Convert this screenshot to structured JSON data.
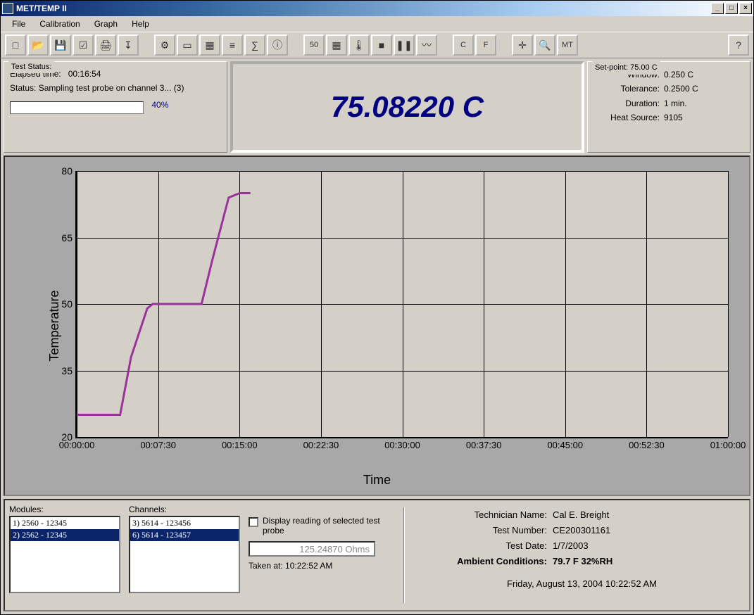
{
  "title": "MET/TEMP II",
  "menu": {
    "file": "File",
    "calibration": "Calibration",
    "graph": "Graph",
    "help": "Help"
  },
  "status": {
    "title": "Test Status:",
    "elapsed_label": "Elapsed time:",
    "elapsed_value": "00:16:54",
    "status_text": "Status: Sampling test probe on channel 3...   (3)",
    "progress_pct": "40%"
  },
  "reading": "75.08220 C",
  "setpoint": {
    "title": "Set-point: 75.00 C",
    "window_label": "Window:",
    "window_value": "0.250 C",
    "tolerance_label": "Tolerance:",
    "tolerance_value": "0.2500 C",
    "duration_label": "Duration:",
    "duration_value": "1 min.",
    "heatsource_label": "Heat Source:",
    "heatsource_value": "9105"
  },
  "chart_data": {
    "type": "line",
    "title": "",
    "xlabel": "Time",
    "ylabel": "Temperature",
    "ylim": [
      20,
      80
    ],
    "y_ticks": [
      20,
      35,
      50,
      65,
      80
    ],
    "x_ticks": [
      "00:00:00",
      "00:07:30",
      "00:15:00",
      "00:22:30",
      "00:30:00",
      "00:37:30",
      "00:45:00",
      "00:52:30",
      "01:00:00"
    ],
    "series": [
      {
        "name": "Temperature",
        "color": "#993399",
        "x": [
          "00:00:00",
          "00:04:00",
          "00:05:00",
          "00:06:30",
          "00:07:00",
          "00:11:30",
          "00:12:30",
          "00:14:00",
          "00:15:00",
          "00:16:00"
        ],
        "y": [
          25,
          25,
          38,
          49,
          50,
          50,
          60,
          74,
          75,
          75
        ]
      }
    ]
  },
  "modules": {
    "label": "Modules:",
    "items": [
      "1) 2560 - 12345",
      "2) 2562 - 12345"
    ],
    "selected": 1
  },
  "channels": {
    "label": "Channels:",
    "items": [
      "3) 5614 - 123456",
      "6) 5614 - 123457"
    ],
    "selected": 1
  },
  "display_reading": {
    "checkbox_label": "Display reading of selected test probe",
    "value": "125.24870 Ohms",
    "taken_label": "Taken at:",
    "taken_value": "10:22:52 AM"
  },
  "info": {
    "tech_label": "Technician Name:",
    "tech_value": "Cal E. Breight",
    "testnum_label": "Test Number:",
    "testnum_value": "CE200301161",
    "testdate_label": "Test Date:",
    "testdate_value": "1/7/2003",
    "ambient_label": "Ambient Conditions:",
    "ambient_value": "79.7 F   32%RH",
    "timestamp": "Friday, August 13, 2004  10:22:52 AM"
  },
  "toolbar_icons": [
    "new",
    "open",
    "save",
    "check",
    "print",
    "export",
    "sep",
    "config",
    "tray",
    "grid-s",
    "strip",
    "calc",
    "info",
    "sep",
    "fifty",
    "grid",
    "thermo",
    "stop",
    "pause",
    "graph",
    "sep",
    "c",
    "f",
    "sep",
    "crosshair",
    "zoom",
    "mt",
    "sep-flex",
    "help"
  ]
}
